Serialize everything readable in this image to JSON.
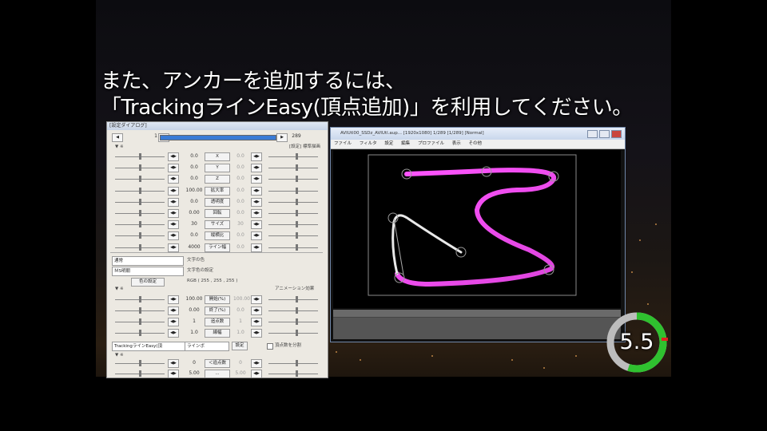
{
  "caption": {
    "line1": "また、アンカーを追加するには、",
    "line2": "「TrackingラインEasy(頂点追加)」を利用してください。"
  },
  "settings_dialog": {
    "title": "[設定ダイアログ]",
    "frame_value": "1",
    "end_value": "289",
    "params": [
      {
        "value": "0.0",
        "label": "X",
        "value2": "0.0"
      },
      {
        "value": "0.0",
        "label": "Y",
        "value2": "0.0"
      },
      {
        "value": "0.0",
        "label": "Z",
        "value2": "0.0"
      },
      {
        "value": "100.00",
        "label": "拡大率",
        "value2": "0.0"
      },
      {
        "value": "0.0",
        "label": "透明度",
        "value2": "0.0"
      },
      {
        "value": "0.00",
        "label": "回転",
        "value2": "0.0"
      },
      {
        "value": "30",
        "label": "サイズ",
        "value2": "30"
      },
      {
        "value": "0.0",
        "label": "縦横比",
        "value2": "0.0"
      },
      {
        "value": "4000",
        "label": "ライン幅",
        "value2": "0.0"
      }
    ],
    "blend_select": "通常",
    "font_select": "ＭS明朝",
    "color_label": "文字色の設定",
    "bg_color_label": "文字の色",
    "rgb_text": "RGB ( 255 , 255 , 255 )",
    "anim_header": "アニメーション効果",
    "params2": [
      {
        "value": "100.00",
        "label": "開始(%)",
        "value2": "100.00"
      },
      {
        "value": "0.00",
        "label": "終了(%)",
        "value2": "0.0"
      },
      {
        "value": "1",
        "label": "追点数",
        "value2": "1"
      },
      {
        "value": "1.0",
        "label": "線幅",
        "value2": "1.0"
      }
    ],
    "effect_select": "TrackingラインEasy(頂",
    "type_select": "ラインボ",
    "settings_btn": "設定",
    "anchor_toggle": "頂点数を分割",
    "params3": [
      {
        "value": "0",
        "label": "＜追点数",
        "value2": "0"
      },
      {
        "value": "5.00",
        "label": "...",
        "value2": "5.00"
      }
    ]
  },
  "preview_window": {
    "title": "AVIUtl00_SSDz_AVIUtl.aup... [1920x1080] 1/289 [1/289]  [Normal]",
    "menu": [
      "ファイル",
      "フィルタ",
      "設定",
      "編集",
      "プロファイル",
      "表示",
      "その他"
    ]
  },
  "timer": {
    "value": "5.5",
    "progress": 0.55
  }
}
